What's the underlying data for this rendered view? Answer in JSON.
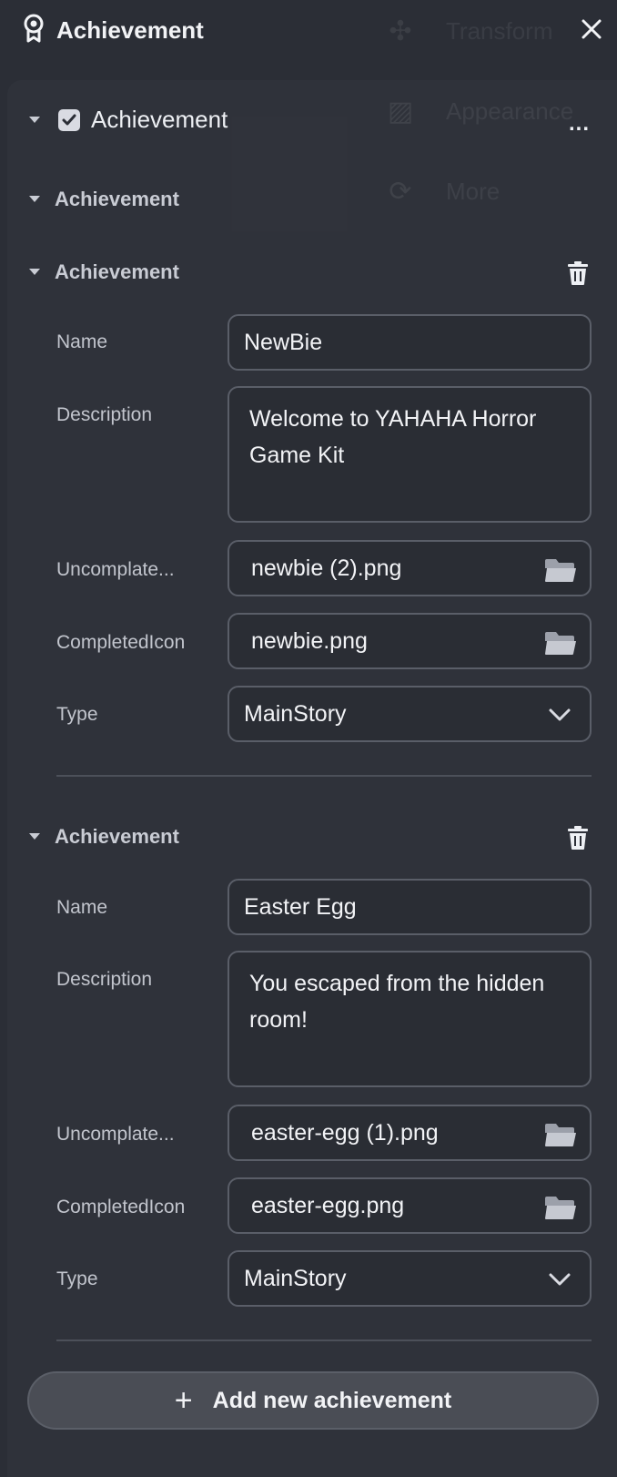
{
  "header": {
    "title": "Achievement"
  },
  "background_menu": {
    "items": [
      {
        "label": "Transform",
        "icon": "transform-icon"
      },
      {
        "label": "Appearance",
        "icon": "appearance-icon"
      },
      {
        "label": "More",
        "icon": "more-icon"
      }
    ]
  },
  "component": {
    "enabled": true,
    "label": "Achievement",
    "more_label": "..."
  },
  "group_label": "Achievement",
  "achievements": [
    {
      "header": "Achievement",
      "fields": {
        "name_label": "Name",
        "name_value": "NewBie",
        "description_label": "Description",
        "description_value": "Welcome to YAHAHA Horror Game Kit",
        "uncompleted_label": "Uncomplate...",
        "uncompleted_value": "newbie (2).png",
        "completed_label": "CompletedIcon",
        "completed_value": "newbie.png",
        "type_label": "Type",
        "type_value": "MainStory"
      }
    },
    {
      "header": "Achievement",
      "fields": {
        "name_label": "Name",
        "name_value": "Easter Egg",
        "description_label": "Description",
        "description_value": "You escaped from the hidden room!",
        "uncompleted_label": "Uncomplate...",
        "uncompleted_value": "easter-egg (1).png",
        "completed_label": "CompletedIcon",
        "completed_value": "easter-egg.png",
        "type_label": "Type",
        "type_value": "MainStory"
      }
    }
  ],
  "add_button_label": "Add new achievement"
}
